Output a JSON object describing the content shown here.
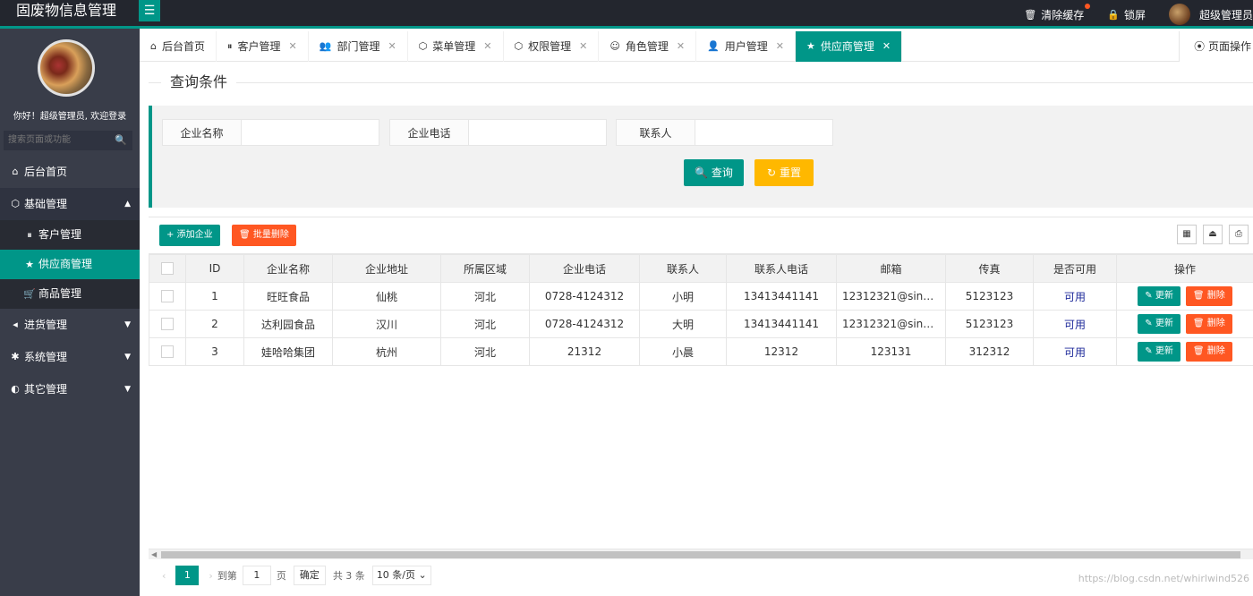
{
  "app": {
    "title": "固废物信息管理",
    "menu_toggle_icon": "hamburger-icon",
    "accent": "#009688"
  },
  "header": {
    "clear_cache": "清除缓存",
    "lock_screen": "锁屏",
    "user_name": "超级管理员"
  },
  "sidebar": {
    "welcome": "你好！超级管理员, 欢迎登录",
    "search_placeholder": "搜索页面或功能",
    "items": [
      {
        "label": "后台首页",
        "icon": "home-icon"
      },
      {
        "label": "基础管理",
        "icon": "cube-icon"
      },
      {
        "label": "客户管理",
        "icon": "pause-circle-icon"
      },
      {
        "label": "供应商管理",
        "icon": "star-icon"
      },
      {
        "label": "商品管理",
        "icon": "cart-icon"
      },
      {
        "label": "进货管理",
        "icon": "sound-icon"
      },
      {
        "label": "系统管理",
        "icon": "gear-icon"
      },
      {
        "label": "其它管理",
        "icon": "circle-icon"
      }
    ]
  },
  "tabs": [
    {
      "label": "后台首页",
      "icon": "home-icon"
    },
    {
      "label": "客户管理",
      "icon": "pause-circle-icon"
    },
    {
      "label": "部门管理",
      "icon": "users-icon"
    },
    {
      "label": "菜单管理",
      "icon": "cube-icon"
    },
    {
      "label": "权限管理",
      "icon": "cube-icon"
    },
    {
      "label": "角色管理",
      "icon": "smile-icon"
    },
    {
      "label": "用户管理",
      "icon": "user-icon"
    },
    {
      "label": "供应商管理",
      "icon": "star-icon"
    }
  ],
  "page_ops": "页面操作",
  "query": {
    "title": "查询条件",
    "field1_label": "企业名称",
    "field2_label": "企业电话",
    "field3_label": "联系人",
    "search_btn": "查询",
    "reset_btn": "重置"
  },
  "toolbar": {
    "add_btn": "添加企业",
    "batch_delete_btn": "批量删除"
  },
  "table": {
    "columns": [
      "",
      "ID",
      "企业名称",
      "企业地址",
      "所属区域",
      "企业电话",
      "联系人",
      "联系人电话",
      "邮箱",
      "传真",
      "是否可用",
      "操作"
    ],
    "rows": [
      [
        "1",
        "旺旺食品",
        "仙桃",
        "河北",
        "0728-4124312",
        "小明",
        "13413441141",
        "12312321@sina...",
        "5123123",
        "可用"
      ],
      [
        "2",
        "达利园食品",
        "汉川",
        "河北",
        "0728-4124312",
        "大明",
        "13413441141",
        "12312321@sina...",
        "5123123",
        "可用"
      ],
      [
        "3",
        "娃哈哈集团",
        "杭州",
        "河北",
        "21312",
        "小晨",
        "12312",
        "123131",
        "312312",
        "可用"
      ]
    ],
    "update_btn": "更新",
    "delete_btn": "删除"
  },
  "pager": {
    "current": "1",
    "goto_label": "到第",
    "goto_value": "1",
    "page_label": "页",
    "ok_btn": "确定",
    "total": "共 3 条",
    "page_size": "10 条/页"
  },
  "watermark": "https://blog.csdn.net/whirlwind526"
}
